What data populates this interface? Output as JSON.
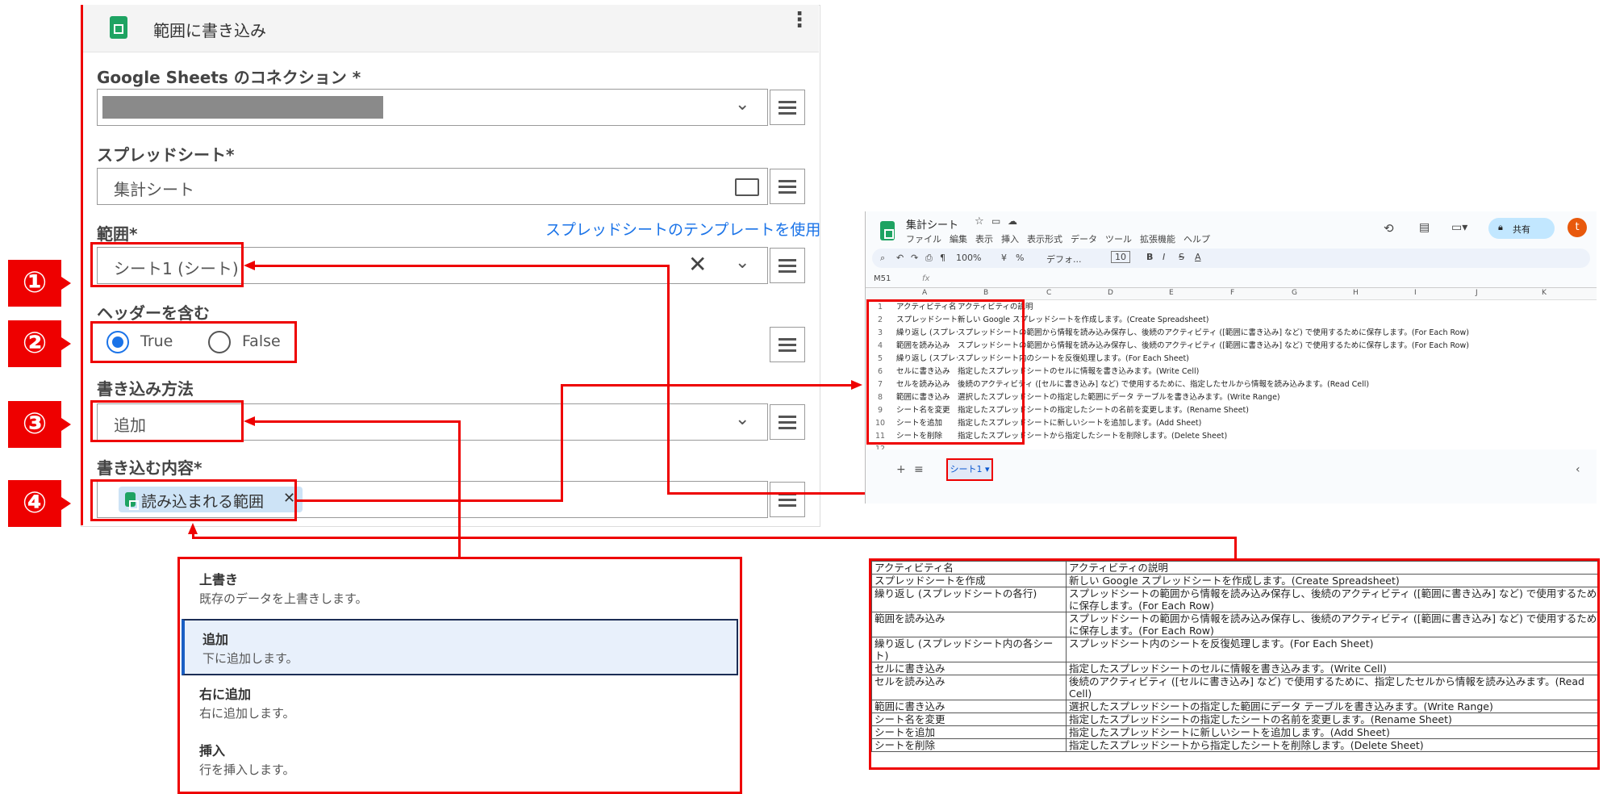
{
  "panel": {
    "title": "範囲に書き込み",
    "more_icon": "more-vert-icon",
    "connection_label": "Google Sheets のコネクション *",
    "spreadsheet_label": "スプレッドシート*",
    "spreadsheet_value": "集計シート",
    "range_label": "範囲*",
    "range_template_link": "スプレッドシートのテンプレートを使用",
    "range_value": "シート1 (シート)",
    "header_label": "ヘッダーを含む",
    "radio_true": "True",
    "radio_false": "False",
    "write_method_label": "書き込み方法",
    "write_method_value": "追加",
    "content_label": "書き込む内容*",
    "content_chip": "読み込まれる範囲"
  },
  "markers": [
    "①",
    "②",
    "③",
    "④"
  ],
  "menu": [
    {
      "title": "上書き",
      "desc": "既存のデータを上書きします。",
      "selected": false
    },
    {
      "title": "追加",
      "desc": "下に追加します。",
      "selected": true
    },
    {
      "title": "右に追加",
      "desc": "右に追加します。",
      "selected": false
    },
    {
      "title": "挿入",
      "desc": "行を挿入します。",
      "selected": false
    }
  ],
  "sheet": {
    "title": "集計シート",
    "menus": [
      "ファイル",
      "編集",
      "表示",
      "挿入",
      "表示形式",
      "データ",
      "ツール",
      "拡張機能",
      "ヘルプ"
    ],
    "share": "共有",
    "avatar": "t",
    "zoom": "100%",
    "font": "デフォ...",
    "font_size": "10",
    "cell_ref": "M51",
    "fx": "fx",
    "columns": [
      "A",
      "B",
      "C",
      "D",
      "E",
      "F",
      "G",
      "H",
      "I",
      "J",
      "K"
    ],
    "rows": [
      {
        "n": "1",
        "a": "アクティビティ名",
        "b": "アクティビティの説明"
      },
      {
        "n": "2",
        "a": "スプレッドシートを作成",
        "b": "新しい Google スプレッドシートを作成します。(Create Spreadsheet)"
      },
      {
        "n": "3",
        "a": "繰り返し (スプレッドシートの各行)",
        "b": "スプレッドシートの範囲から情報を読み込み保存し、後続のアクティビティ ([範囲に書き込み] など) で使用するために保存します。(For Each Row)"
      },
      {
        "n": "4",
        "a": "範囲を読み込み",
        "b": "スプレッドシートの範囲から情報を読み込み保存し、後続のアクティビティ ([範囲に書き込み] など) で使用するために保存します。(For Each Row)"
      },
      {
        "n": "5",
        "a": "繰り返し (スプレッドシート内の各シート)",
        "b": "スプレッドシート内のシートを反復処理します。(For Each Sheet)"
      },
      {
        "n": "6",
        "a": "セルに書き込み",
        "b": "指定したスプレッドシートのセルに情報を書き込みます。(Write Cell)"
      },
      {
        "n": "7",
        "a": "セルを読み込み",
        "b": "後続のアクティビティ ([セルに書き込み] など) で使用するために、指定したセルから情報を読み込みます。(Read Cell)"
      },
      {
        "n": "8",
        "a": "範囲に書き込み",
        "b": "選択したスプレッドシートの指定した範囲にデータ テーブルを書き込みます。(Write Range)"
      },
      {
        "n": "9",
        "a": "シート名を変更",
        "b": "指定したスプレッドシートの指定したシートの名前を変更します。(Rename Sheet)"
      },
      {
        "n": "10",
        "a": "シートを追加",
        "b": "指定したスプレッドシートに新しいシートを追加します。(Add Sheet)"
      },
      {
        "n": "11",
        "a": "シートを削除",
        "b": "指定したスプレッドシートから指定したシートを削除します。(Delete Sheet)"
      },
      {
        "n": "12",
        "a": "",
        "b": ""
      }
    ],
    "tab": "シート1"
  },
  "table": [
    [
      "アクティビティ名",
      "アクティビティの説明"
    ],
    [
      "スプレッドシートを作成",
      "新しい Google スプレッドシートを作成します。(Create Spreadsheet)"
    ],
    [
      "繰り返し (スプレッドシートの各行)",
      "スプレッドシートの範囲から情報を読み込み保存し、後続のアクティビティ ([範囲に書き込み] など) で使用するために保存します。(For Each Row)"
    ],
    [
      "範囲を読み込み",
      "スプレッドシートの範囲から情報を読み込み保存し、後続のアクティビティ ([範囲に書き込み] など) で使用するために保存します。(For Each Row)"
    ],
    [
      "繰り返し (スプレッドシート内の各シート)",
      "スプレッドシート内のシートを反復処理します。(For Each Sheet)"
    ],
    [
      "セルに書き込み",
      "指定したスプレッドシートのセルに情報を書き込みます。(Write Cell)"
    ],
    [
      "セルを読み込み",
      "後続のアクティビティ ([セルに書き込み] など) で使用するために、指定したセルから情報を読み込みます。(Read Cell)"
    ],
    [
      "範囲に書き込み",
      "選択したスプレッドシートの指定した範囲にデータ テーブルを書き込みます。(Write Range)"
    ],
    [
      "シート名を変更",
      "指定したスプレッドシートの指定したシートの名前を変更します。(Rename Sheet)"
    ],
    [
      "シートを追加",
      "指定したスプレッドシートに新しいシートを追加します。(Add Sheet)"
    ],
    [
      "シートを削除",
      "指定したスプレッドシートから指定したシートを削除します。(Delete Sheet)"
    ]
  ],
  "colors": {
    "accent": "#e00000",
    "link": "#1a73e8",
    "sheets_green": "#1ea362"
  }
}
